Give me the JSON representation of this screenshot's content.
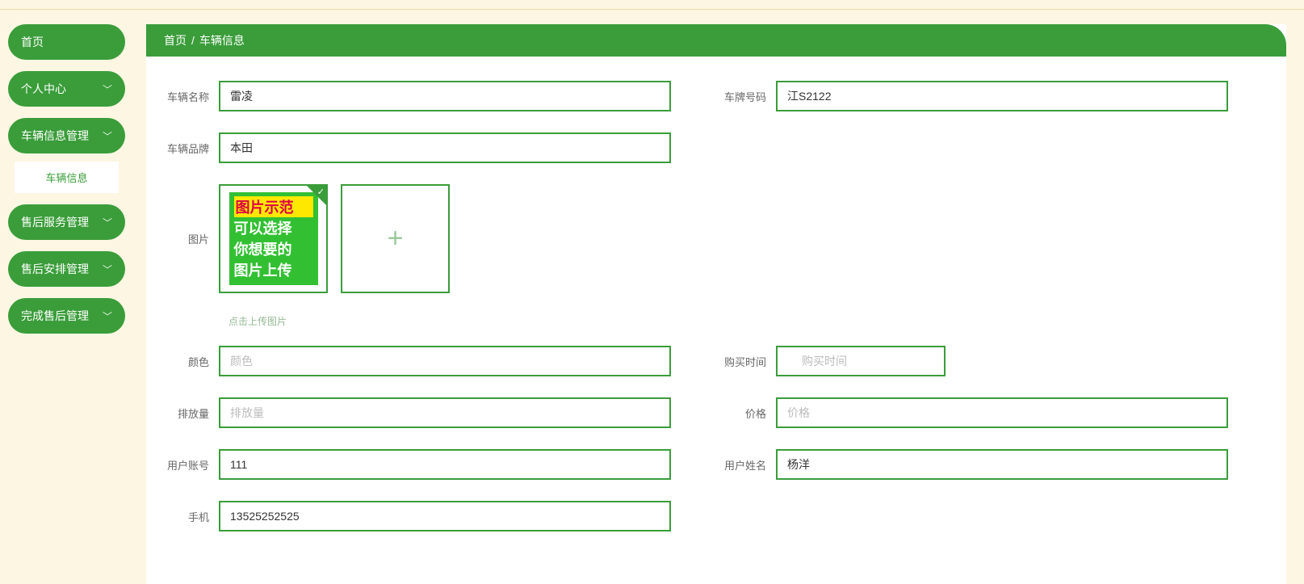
{
  "sidebar": {
    "items": [
      {
        "label": "首页",
        "expandable": false
      },
      {
        "label": "个人中心",
        "expandable": true
      },
      {
        "label": "车辆信息管理",
        "expandable": true,
        "sub": "车辆信息"
      },
      {
        "label": "售后服务管理",
        "expandable": true
      },
      {
        "label": "售后安排管理",
        "expandable": true
      },
      {
        "label": "完成售后管理",
        "expandable": true
      }
    ]
  },
  "breadcrumb": {
    "home": "首页",
    "sep": "/",
    "current": "车辆信息"
  },
  "form": {
    "vehicle_name": {
      "label": "车辆名称",
      "value": "雷凌"
    },
    "plate_no": {
      "label": "车牌号码",
      "value": "江S2122"
    },
    "brand": {
      "label": "车辆品牌",
      "value": "本田"
    },
    "image": {
      "label": "图片",
      "sample_lines": [
        "图片示范",
        "可以选择",
        "你想要的",
        "图片上传"
      ]
    },
    "upload_hint": "点击上传图片",
    "color": {
      "label": "颜色",
      "value": "",
      "placeholder": "颜色"
    },
    "buy_time": {
      "label": "购买时间",
      "value": "",
      "placeholder": "购买时间"
    },
    "emission": {
      "label": "排放量",
      "value": "",
      "placeholder": "排放量"
    },
    "price": {
      "label": "价格",
      "value": "",
      "placeholder": "价格"
    },
    "user_account": {
      "label": "用户账号",
      "value": "111"
    },
    "user_name": {
      "label": "用户姓名",
      "value": "杨洋"
    },
    "phone": {
      "label": "手机",
      "value": "13525252525"
    }
  }
}
